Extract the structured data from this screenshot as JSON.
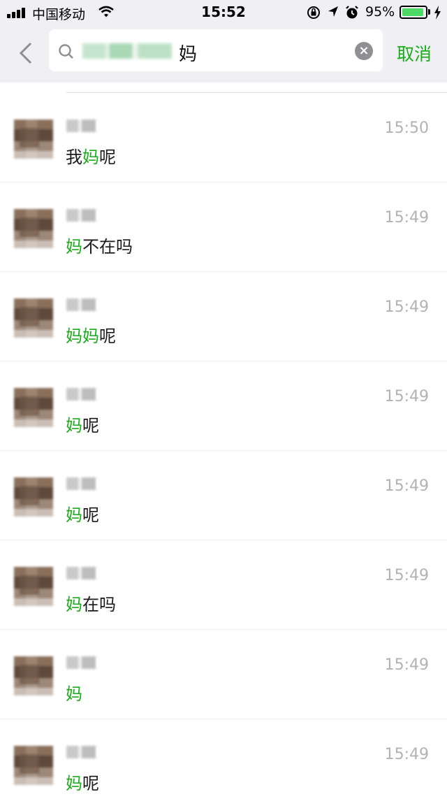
{
  "status_bar": {
    "carrier": "中国移动",
    "time": "15:52",
    "battery_percent": "95%",
    "battery_level": 0.95
  },
  "search": {
    "query_visible": "妈",
    "cancel_label": "取消"
  },
  "results": [
    {
      "time": "15:50",
      "before": "我",
      "highlight": "妈",
      "after": "呢"
    },
    {
      "time": "15:49",
      "before": "",
      "highlight": "妈",
      "after": "不在吗"
    },
    {
      "time": "15:49",
      "before": "",
      "highlight": "妈妈",
      "after": "呢"
    },
    {
      "time": "15:49",
      "before": "",
      "highlight": "妈",
      "after": "呢"
    },
    {
      "time": "15:49",
      "before": "",
      "highlight": "妈",
      "after": "呢"
    },
    {
      "time": "15:49",
      "before": "",
      "highlight": "妈",
      "after": "在吗"
    },
    {
      "time": "15:49",
      "before": "",
      "highlight": "妈",
      "after": ""
    },
    {
      "time": "15:49",
      "before": "",
      "highlight": "妈",
      "after": "呢"
    }
  ],
  "colors": {
    "accent_green": "#1aad19",
    "battery_green": "#4cd964",
    "header_bg": "#efeff4",
    "time_gray": "#b2b2b2"
  },
  "icons": [
    "signal-icon",
    "wifi-icon",
    "rotation-lock-icon",
    "location-icon",
    "alarm-icon",
    "battery-icon",
    "charging-icon",
    "back-chevron-icon",
    "search-icon",
    "clear-icon"
  ]
}
